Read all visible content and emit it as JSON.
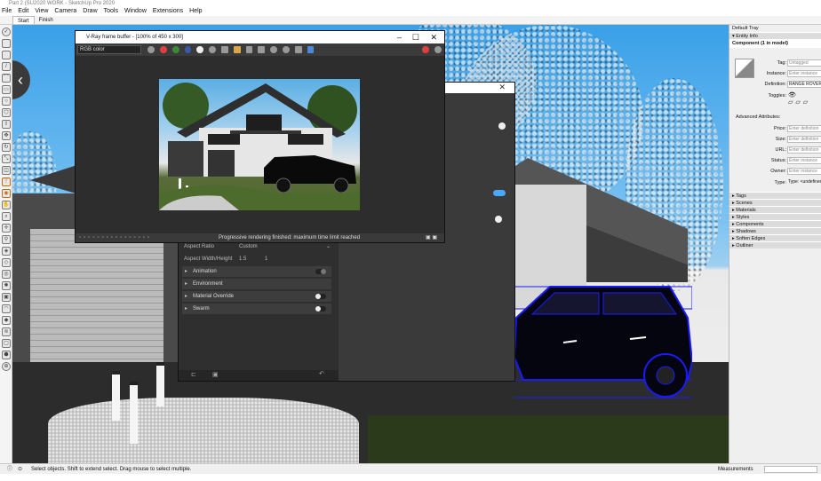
{
  "window": {
    "title": "Part 2 (SU2020 WORK - SketchUp Pro 2020"
  },
  "menu": [
    "File",
    "Edit",
    "View",
    "Camera",
    "Draw",
    "Tools",
    "Window",
    "Extensions",
    "Help"
  ],
  "scene_tabs": [
    {
      "label": "Start"
    },
    {
      "label": "Finish"
    }
  ],
  "vfb": {
    "title": "V-Ray frame buffer - [100% of 450 x 300]",
    "channel": "RGB color",
    "status": "Progressive rendering finished: maximum time limit reached"
  },
  "vray_dialog": {
    "aspect_ratio_label": "Aspect Ratio",
    "aspect_ratio_value": "Custom",
    "aspect_wh_label": "Aspect Width/Height",
    "aspect_w": "1.5",
    "aspect_h": "1",
    "rollouts": [
      {
        "label": "Animation"
      },
      {
        "label": "Environment"
      },
      {
        "label": "Material Override"
      },
      {
        "label": "Swarm"
      }
    ]
  },
  "tray": {
    "title": "Default Tray",
    "panel": "Entity Info",
    "component_name": "Component (1 in model)",
    "tag_label": "Tag:",
    "tag_value": "Untagged",
    "instance_label": "Instance:",
    "instance_placeholder": "Enter instance",
    "definition_label": "Definition:",
    "definition_value": "RANGE ROVER",
    "toggles_label": "Toggles:",
    "advanced_label": "Advanced Attributes:",
    "price_label": "Price:",
    "price_placeholder": "Enter definition",
    "size_label": "Size:",
    "size_placeholder": "Enter definition",
    "url_label": "URL:",
    "url_placeholder": "Enter definition",
    "status_label": "Status:",
    "status_placeholder": "Enter instance",
    "owner_label": "Owner:",
    "owner_placeholder": "Enter instance",
    "type_label": "Type:",
    "type_value": "Type: <undefined>",
    "sections": [
      "Tags",
      "Scenes",
      "Materials",
      "Styles",
      "Components",
      "Shadows",
      "Soften Edges",
      "Outliner"
    ]
  },
  "statusbar": {
    "hint": "Select objects. Shift to extend select. Drag mouse to select multiple.",
    "measurements_label": "Measurements"
  },
  "colors": {
    "selection": "#1a1aff",
    "vray_bg": "#2f2f2f",
    "sky": "#3aa0e8"
  }
}
